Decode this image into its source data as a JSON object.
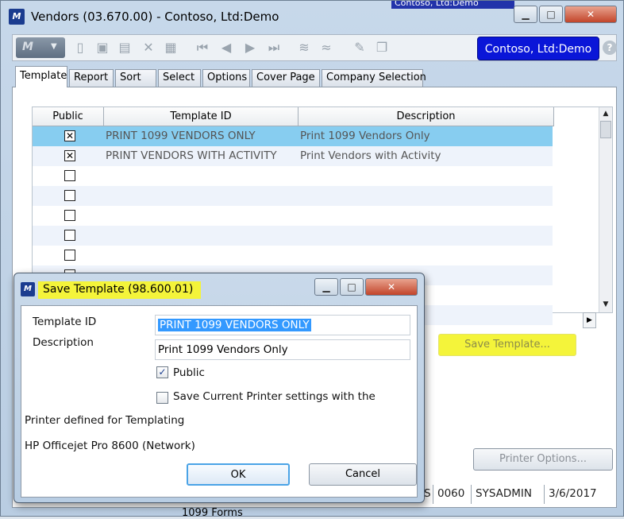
{
  "colors": {
    "company_badge": "#0a16d8",
    "highlight": "#f4f43a",
    "selected_row": "#87cdf0"
  },
  "behind_window_text": "Contoso, Ltd:Demo",
  "main_window": {
    "title": "Vendors (03.670.00) - Contoso, Ltd:Demo",
    "company_badge": "Contoso, Ltd:Demo",
    "help_icon": "?",
    "tabs": [
      {
        "label": "Template"
      },
      {
        "label": "Report"
      },
      {
        "label": "Sort"
      },
      {
        "label": "Select"
      },
      {
        "label": "Options"
      },
      {
        "label": "Cover Page"
      },
      {
        "label": "Company Selection"
      }
    ],
    "grid": {
      "headers": {
        "public": "Public",
        "template_id": "Template ID",
        "description": "Description"
      },
      "rows": [
        {
          "public": true,
          "template_id": "PRINT 1099 VENDORS ONLY",
          "description": "Print 1099 Vendors Only",
          "selected": true
        },
        {
          "public": true,
          "template_id": "PRINT VENDORS WITH ACTIVITY",
          "description": "Print Vendors with Activity"
        },
        {
          "public": false,
          "template_id": "",
          "description": ""
        },
        {
          "public": false,
          "template_id": "",
          "description": ""
        },
        {
          "public": false,
          "template_id": "",
          "description": ""
        },
        {
          "public": false,
          "template_id": "",
          "description": ""
        },
        {
          "public": false,
          "template_id": "",
          "description": ""
        },
        {
          "public": false,
          "template_id": "",
          "description": ""
        },
        {
          "public": false,
          "template_id": "",
          "description": ""
        },
        {
          "public": false,
          "template_id": "",
          "description": ""
        }
      ]
    },
    "buttons": {
      "save_template": "Save Template...",
      "printer_options": "Printer Options..."
    },
    "status_bar": {
      "cell1": "S",
      "cell2": "0060",
      "cell3": "SYSADMIN",
      "cell4": "3/6/2017"
    },
    "bottom_cut_text": "1099 Forms"
  },
  "dialog": {
    "title": "Save Template (98.600.01)",
    "template_id_label": "Template ID",
    "template_id_value": "PRINT 1099 VENDORS ONLY",
    "description_label": "Description",
    "description_value": "Print 1099 Vendors Only",
    "public_label": "Public",
    "public_checked": true,
    "save_printer_label": "Save Current Printer settings with the",
    "save_printer_checked": false,
    "printer_defined_label": "Printer defined for Templating",
    "printer_name": "HP Officejet Pro 8600 (Network)",
    "ok_label": "OK",
    "cancel_label": "Cancel"
  }
}
